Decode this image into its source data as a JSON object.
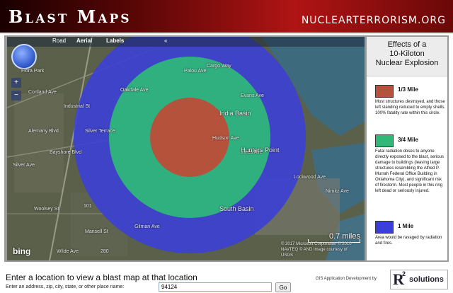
{
  "header": {
    "title": "Blast Maps",
    "site": "NUCLEARTERRORISM.ORG"
  },
  "map_toolbar": {
    "road": "Road",
    "aerial": "Aerial",
    "labels": "Labels",
    "collapse": "«"
  },
  "map_labels": [
    "Cortland Ave",
    "Alemany Blvd",
    "Industrial St",
    "Bayshore Blvd",
    "Silver Ave",
    "Palou Ave",
    "Oakdale Ave",
    "Evans Ave",
    "Lockwood Ave",
    "Innes Ave",
    "Hudson Ave",
    "Cargo Way",
    "India Basin",
    "Hunters Point",
    "South Basin",
    "Silver Terrace",
    "Gilman Ave",
    "Wilde Ave",
    "Woolsey St",
    "Mansell St",
    "Nimitz Ave",
    "Flora Park",
    "101",
    "280"
  ],
  "map": {
    "scale_label": "0.7 miles",
    "copyright": "© 2017 Microsoft Corporation  © 2010 NAVTEQ  © AND  Image courtesy of USGS",
    "logo": "bing"
  },
  "colors": {
    "ring_inner": "#b5523b",
    "ring_middle": "#2fb878",
    "ring_outer": "#3a3fd8"
  },
  "legend": {
    "title_line1": "Effects of a",
    "title_line2": "10-Kiloton",
    "title_line3": "Nuclear Explosion",
    "rings": [
      {
        "label": "1/3 Mile",
        "color": "#b5523b",
        "desc": "Most structures destroyed, and those left standing reduced to empty shells. 100% fatality rate within this circle."
      },
      {
        "label": "3/4 Mile",
        "color": "#2fb878",
        "desc": "Fatal radiation doses to anyone directly exposed to the blast, serious damage to buildings (leaving large structures resembling the Alfred P. Murrah Federal Office Building in Oklahoma City), and significant risk of firestorm. Most people in this ring left dead or seriously injured."
      },
      {
        "label": "1 Mile",
        "color": "#3a3fd8",
        "desc": "Area would be ravaged by radiation and fires."
      }
    ]
  },
  "search": {
    "prompt": "Enter a location to view a blast map at that location",
    "label": "Enter an address, zip, city, state, or other place name:",
    "value": "94124",
    "go": "Go"
  },
  "credit": {
    "text": "GIS Application Development by",
    "logo_r": "R",
    "logo_sup": "2",
    "logo_solutions": "solutions"
  }
}
